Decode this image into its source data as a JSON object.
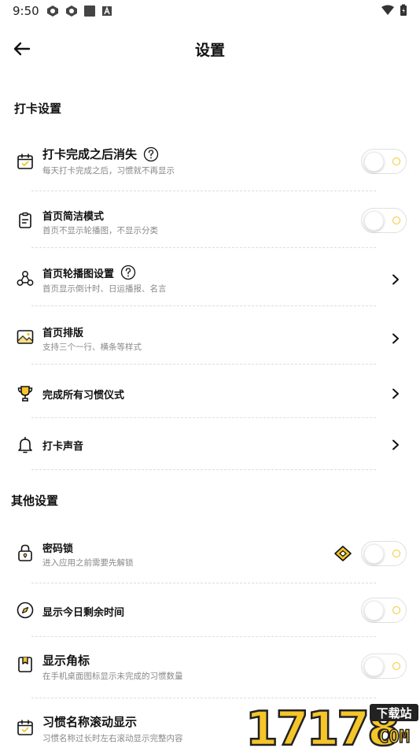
{
  "status_bar": {
    "time": "9:50"
  },
  "header": {
    "title": "设置"
  },
  "sections": {
    "checkin": {
      "title": "打卡设置"
    },
    "other": {
      "title": "其他设置"
    }
  },
  "rows": {
    "disappear": {
      "title": "打卡完成之后消失",
      "subtitle": "每天打卡完成之后，习惯就不再显示"
    },
    "simple_mode": {
      "title": "首页简洁模式",
      "subtitle": "首页不显示轮播图，不显示分类"
    },
    "carousel": {
      "title": "首页轮播图设置",
      "subtitle": "首页显示倒计时、日运播报、名言"
    },
    "layout": {
      "title": "首页排版",
      "subtitle": "支持三个一行、横条等样式"
    },
    "ritual": {
      "title": "完成所有习惯仪式"
    },
    "sound": {
      "title": "打卡声音"
    },
    "password": {
      "title": "密码锁",
      "subtitle": "进入应用之前需要先解锁"
    },
    "remaining": {
      "title": "显示今日剩余时间"
    },
    "badge": {
      "title": "显示角标",
      "subtitle": "在手机桌面图标显示未完成的习惯数量"
    },
    "scroll": {
      "title": "习惯名称滚动显示",
      "subtitle": "习惯名称过长时左右滚动显示完整内容"
    }
  },
  "watermark": {
    "digits": "17178",
    "label": "下载站",
    "suffix": "COM"
  },
  "colors": {
    "accent": "#f5c52a",
    "text": "#111111",
    "subtext": "#888888"
  }
}
